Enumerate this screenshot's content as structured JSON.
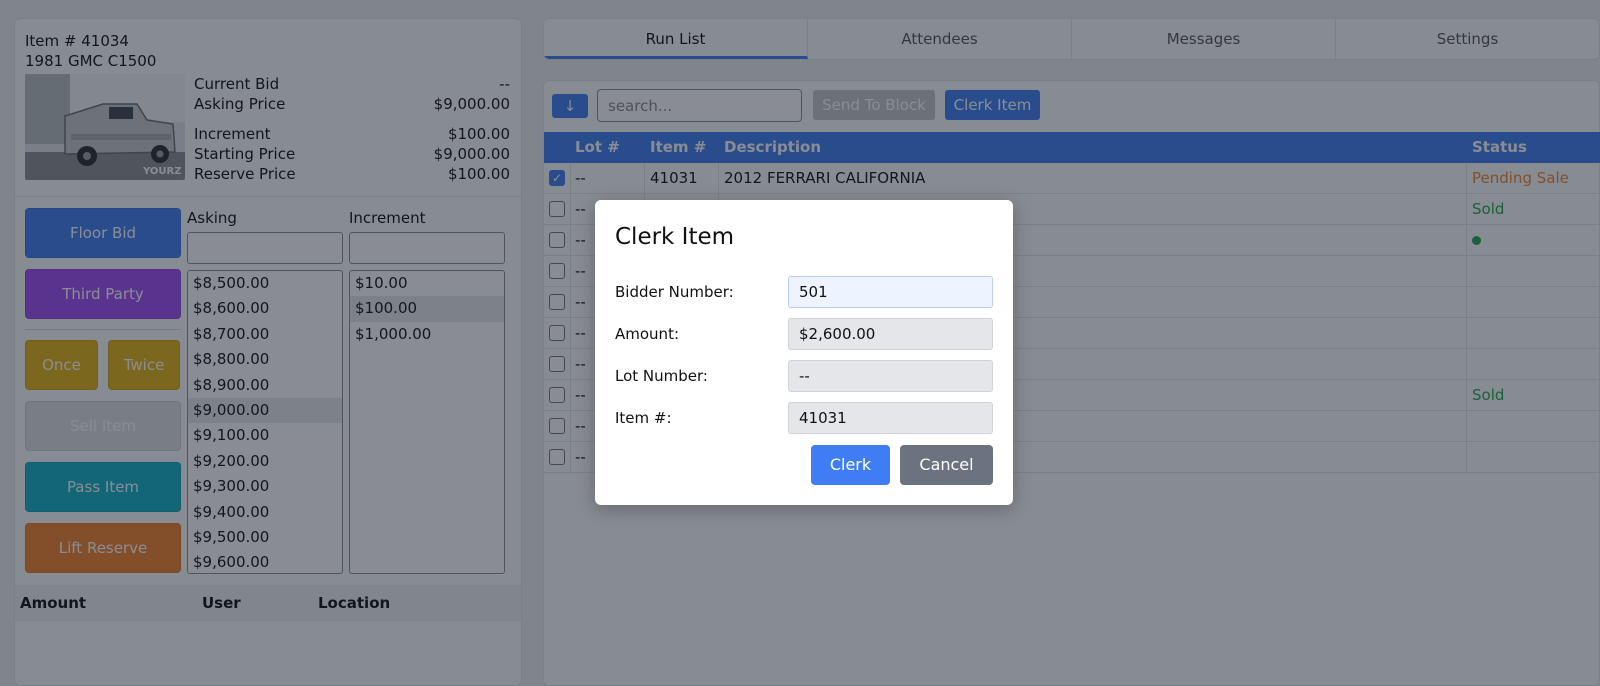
{
  "item": {
    "number_label": "Item # 41034",
    "name": "1981 GMC C1500",
    "image_watermark": "YOURZ",
    "current_bid_label": "Current Bid",
    "current_bid": "--",
    "asking_price_label": "Asking Price",
    "asking_price": "$9,000.00",
    "increment_label": "Increment",
    "increment": "$100.00",
    "starting_price_label": "Starting Price",
    "starting_price": "$9,000.00",
    "reserve_price_label": "Reserve Price",
    "reserve_price": "$100.00"
  },
  "actions": {
    "floor_bid": "Floor Bid",
    "third_party": "Third Party",
    "once": "Once",
    "twice": "Twice",
    "sell_item": "Sell Item",
    "pass_item": "Pass Item",
    "lift_reserve": "Lift Reserve"
  },
  "asking": {
    "label": "Asking",
    "options": [
      "$8,500.00",
      "$8,600.00",
      "$8,700.00",
      "$8,800.00",
      "$8,900.00",
      "$9,000.00",
      "$9,100.00",
      "$9,200.00",
      "$9,300.00",
      "$9,400.00",
      "$9,500.00",
      "$9,600.00"
    ],
    "selected": "$9,000.00"
  },
  "increment_list": {
    "label": "Increment",
    "options": [
      "$10.00",
      "$100.00",
      "$1,000.00"
    ],
    "selected": "$100.00"
  },
  "bid_history": {
    "columns": [
      "Amount",
      "User",
      "Location"
    ]
  },
  "tabs": [
    "Run List",
    "Attendees",
    "Messages",
    "Settings"
  ],
  "active_tab": "Run List",
  "toolbar": {
    "sort_icon": "arrow-down-icon",
    "search_placeholder": "search...",
    "send_to_block": "Send To Block",
    "clerk_item": "Clerk Item"
  },
  "runlist": {
    "columns": [
      "Lot #",
      "Item #",
      "Description",
      "Status"
    ],
    "rows": [
      {
        "checked": true,
        "lot": "--",
        "item": "41031",
        "description": "2012 FERRARI CALIFORNIA",
        "status": "Pending Sale",
        "status_type": "pending"
      },
      {
        "checked": false,
        "lot": "--",
        "item": "",
        "description": "",
        "status": "Sold",
        "status_type": "sold"
      },
      {
        "checked": false,
        "lot": "--",
        "item": "",
        "description": "",
        "status": "",
        "status_type": "dot"
      },
      {
        "checked": false,
        "lot": "--",
        "item": "",
        "description": "",
        "status": "",
        "status_type": "none"
      },
      {
        "checked": false,
        "lot": "--",
        "item": "",
        "description": "",
        "status": "",
        "status_type": "none"
      },
      {
        "checked": false,
        "lot": "--",
        "item": "",
        "description": "",
        "status": "",
        "status_type": "none"
      },
      {
        "checked": false,
        "lot": "--",
        "item": "",
        "description": "",
        "status": "",
        "status_type": "none"
      },
      {
        "checked": false,
        "lot": "--",
        "item": "",
        "description": "",
        "status": "Sold",
        "status_type": "sold"
      },
      {
        "checked": false,
        "lot": "--",
        "item": "",
        "description": "",
        "status": "",
        "status_type": "none"
      },
      {
        "checked": false,
        "lot": "--",
        "item": "",
        "description": "",
        "status": "",
        "status_type": "none"
      }
    ]
  },
  "modal": {
    "title": "Clerk Item",
    "bidder_label": "Bidder Number:",
    "bidder_value": "501",
    "amount_label": "Amount:",
    "amount_value": "$2,600.00",
    "lot_label": "Lot Number:",
    "lot_value": "--",
    "item_label": "Item #:",
    "item_value": "41031",
    "clerk_button": "Clerk",
    "cancel_button": "Cancel"
  },
  "colors": {
    "primary": "#3e7df3",
    "third_party": "#a04bf5",
    "once_twice": "#e2b514",
    "pass": "#12aec9",
    "lift": "#f3832d",
    "sold": "#1fa64a",
    "pending": "#f3832d",
    "cancel": "#6b7280"
  }
}
